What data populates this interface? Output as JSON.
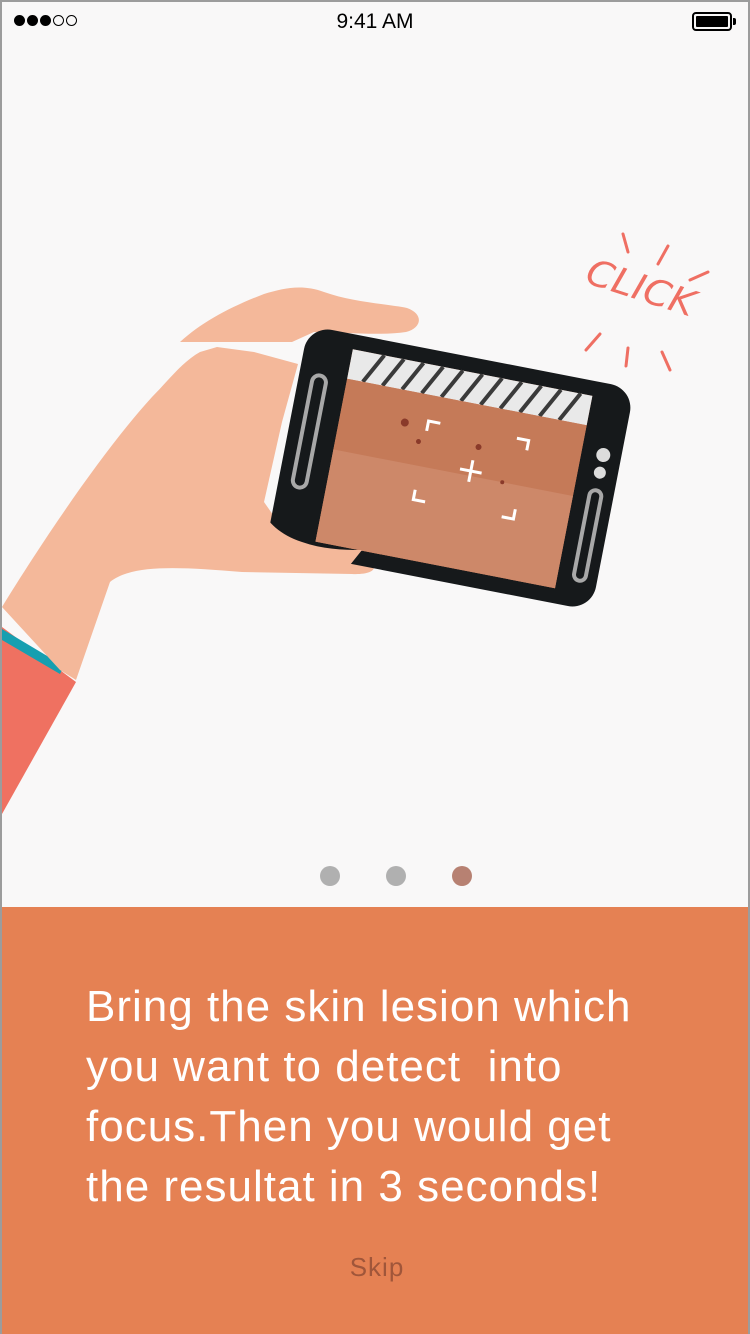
{
  "status_bar": {
    "time": "9:41 AM",
    "signal_dots": [
      true,
      true,
      true,
      false,
      false
    ],
    "battery": "full"
  },
  "illustration": {
    "click_text": "CLICK",
    "subject": "hand holding phone photographing skin lesion"
  },
  "pager": {
    "count": 3,
    "active_index": 2,
    "inactive_color": "#b0b0b0",
    "active_color": "#b78172"
  },
  "onboarding": {
    "description": "Bring the skin lesion which\nyou want to detect  into\nfocus.Then you would get\nthe resultat in 3 seconds!",
    "skip_label": "Skip"
  },
  "colors": {
    "accent": "#e58153",
    "skin": "#f4b89a",
    "sleeve": "#ef7161",
    "cuff": "#169fb0",
    "phone": "#16191b",
    "click": "#ef6f63"
  }
}
